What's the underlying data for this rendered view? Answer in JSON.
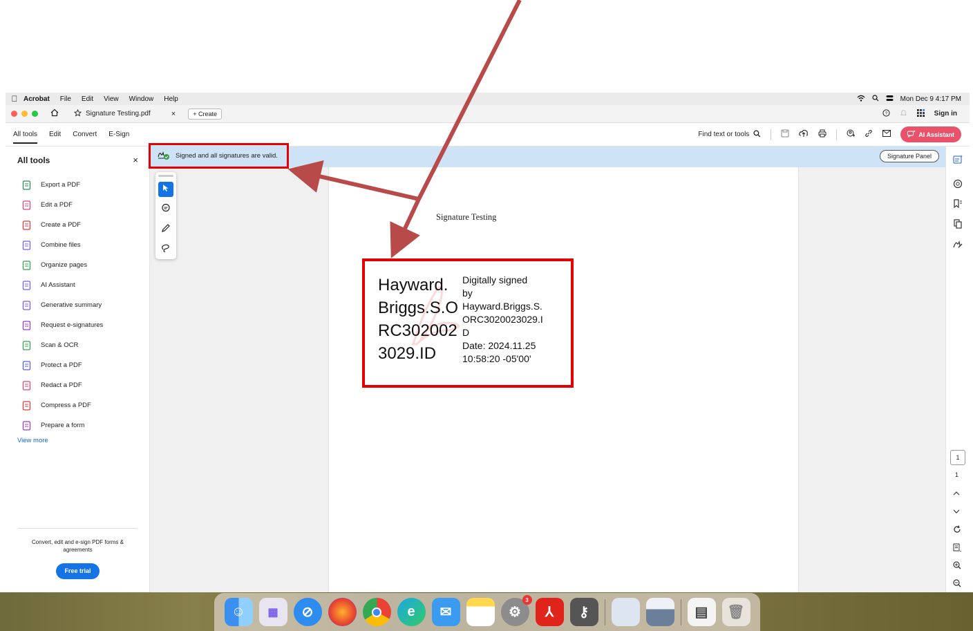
{
  "menubar": {
    "items": [
      "Acrobat",
      "File",
      "Edit",
      "View",
      "Window",
      "Help"
    ],
    "clock": "Mon Dec 9  4:17 PM"
  },
  "tabbar": {
    "tab_title": "Signature Testing.pdf",
    "create_label": "Create",
    "sign_in": "Sign in"
  },
  "toolbar": {
    "tabs": [
      "All tools",
      "Edit",
      "Convert",
      "E-Sign"
    ],
    "find_label": "Find text or tools",
    "ai_label": "AI Assistant"
  },
  "sidebar": {
    "title": "All tools",
    "items": [
      {
        "label": "Export a PDF",
        "color": "#2a8a5a"
      },
      {
        "label": "Edit a PDF",
        "color": "#e0457b"
      },
      {
        "label": "Create a PDF",
        "color": "#e23a3a"
      },
      {
        "label": "Combine files",
        "color": "#7a5cf0"
      },
      {
        "label": "Organize pages",
        "color": "#33a34a"
      },
      {
        "label": "AI Assistant",
        "color": "#7a5cf0"
      },
      {
        "label": "Generative summary",
        "color": "#7a5cf0"
      },
      {
        "label": "Request e-signatures",
        "color": "#9b3cc9"
      },
      {
        "label": "Scan & OCR",
        "color": "#33a34a"
      },
      {
        "label": "Protect a PDF",
        "color": "#5b5ef0"
      },
      {
        "label": "Redact a PDF",
        "color": "#e0457b"
      },
      {
        "label": "Compress a PDF",
        "color": "#e23a3a"
      },
      {
        "label": "Prepare a form",
        "color": "#9b3cc9"
      }
    ],
    "view_more": "View more",
    "promo_text": "Convert, edit and e-sign PDF forms & agreements",
    "trial_label": "Free trial"
  },
  "notification": {
    "message": "Signed and all signatures are valid.",
    "panel_button": "Signature Panel"
  },
  "document": {
    "title": "Signature Testing",
    "signature": {
      "name_lines": [
        "Hayward.",
        "Briggs.S.O",
        "RC302002",
        "3029.ID"
      ],
      "detail_lines": [
        "Digitally signed",
        "by",
        "Hayward.Briggs.S.",
        "ORC3020023029.I",
        "D",
        "Date: 2024.11.25",
        "10:58:20 -05'00'"
      ]
    }
  },
  "pager": {
    "current": "1",
    "total": "1"
  },
  "dock": {
    "apps": [
      "finder-icon",
      "launchpad-icon",
      "safari-icon",
      "firefox-icon",
      "chrome-icon",
      "edge-icon",
      "mail-icon",
      "notes-icon",
      "system-settings-icon",
      "acrobat-icon",
      "keychain-icon",
      "preview-icon",
      "image-capture-icon",
      "downloads-icon",
      "trash-icon"
    ],
    "settings_badge": "3"
  },
  "colors": {
    "accent": "#1473e6",
    "highlight": "#e60000",
    "notification_bg": "#cfe3f6",
    "annotation_arrow": "#b84a4a"
  }
}
